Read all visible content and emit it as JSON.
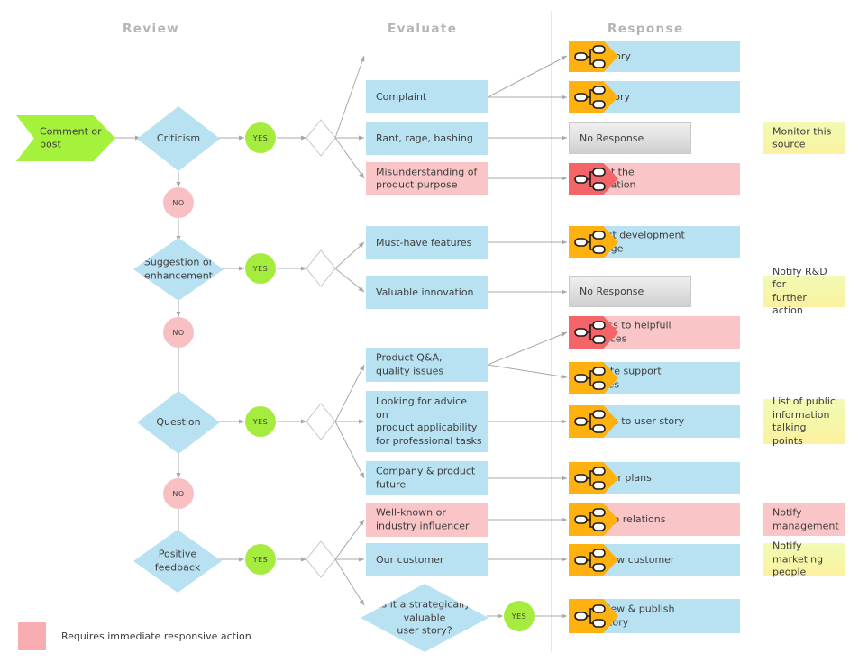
{
  "lanes": [
    {
      "label": "Review"
    },
    {
      "label": "Evaluate"
    },
    {
      "label": "Response"
    }
  ],
  "start": {
    "label": "Comment or\npost"
  },
  "decisions": [
    {
      "label": "Criticism"
    },
    {
      "label": "Suggestion or\nenhancement"
    },
    {
      "label": "Question"
    },
    {
      "label": "Positive\nfeedback"
    },
    {
      "label": "Is it a strategically\nvaluable\nuser story?"
    }
  ],
  "yes_label": "YES",
  "no_label": "NO",
  "evaluate": [
    {
      "label": "Complaint"
    },
    {
      "label": "Rant, rage, bashing"
    },
    {
      "label": "Misunderstanding of\nproduct purpose"
    },
    {
      "label": "Must-have features"
    },
    {
      "label": "Valuable innovation"
    },
    {
      "label": "Product Q&A,\nquality issues"
    },
    {
      "label": "Looking for advice on\nproduct applicability\nfor professional tasks"
    },
    {
      "label": "Company & product\nfuture"
    },
    {
      "label": "Well-known or\nindustry influencer"
    },
    {
      "label": "Our customer"
    }
  ],
  "response": [
    {
      "label": "Long story"
    },
    {
      "label": "Brief story"
    },
    {
      "label": "No Response"
    },
    {
      "label": "Correct the\ninformation"
    },
    {
      "label": "Product development\nmessage"
    },
    {
      "label": "No Response"
    },
    {
      "label": "Address to helpfull\nresources"
    },
    {
      "label": "Promote support\nservices"
    },
    {
      "label": "Address to user story"
    },
    {
      "label": "Discover plans"
    },
    {
      "label": "Develop relations"
    },
    {
      "label": "Interview customer"
    },
    {
      "label": "Interview & publish\nuser story"
    }
  ],
  "notes": [
    {
      "label": "Monitor this\nsource"
    },
    {
      "label": "Notify R&D for\nfurther action"
    },
    {
      "label": "List of public\ninformation\ntalking points"
    },
    {
      "label": "Notify\nmanagement"
    },
    {
      "label": "Notify marketing\npeople"
    }
  ],
  "legend": {
    "label": "Requires immediate responsive action"
  },
  "icons": {
    "action_tag": "share-network-icon"
  },
  "colors": {
    "blue": "#b8e2f2",
    "pink": "#f9c5c7",
    "green": "#a5f23c",
    "yes_green": "#a5ec3e",
    "no_pink": "#f9c0c3",
    "orange": "#ffb110",
    "red": "#f4656a",
    "yellow": "#f4f7a8",
    "gray": "#dedede",
    "lane_divider": "#d8ecf5",
    "lane_title": "#b5b5b5",
    "text": "#3d3d3d",
    "connector": "#a8a8a8"
  }
}
